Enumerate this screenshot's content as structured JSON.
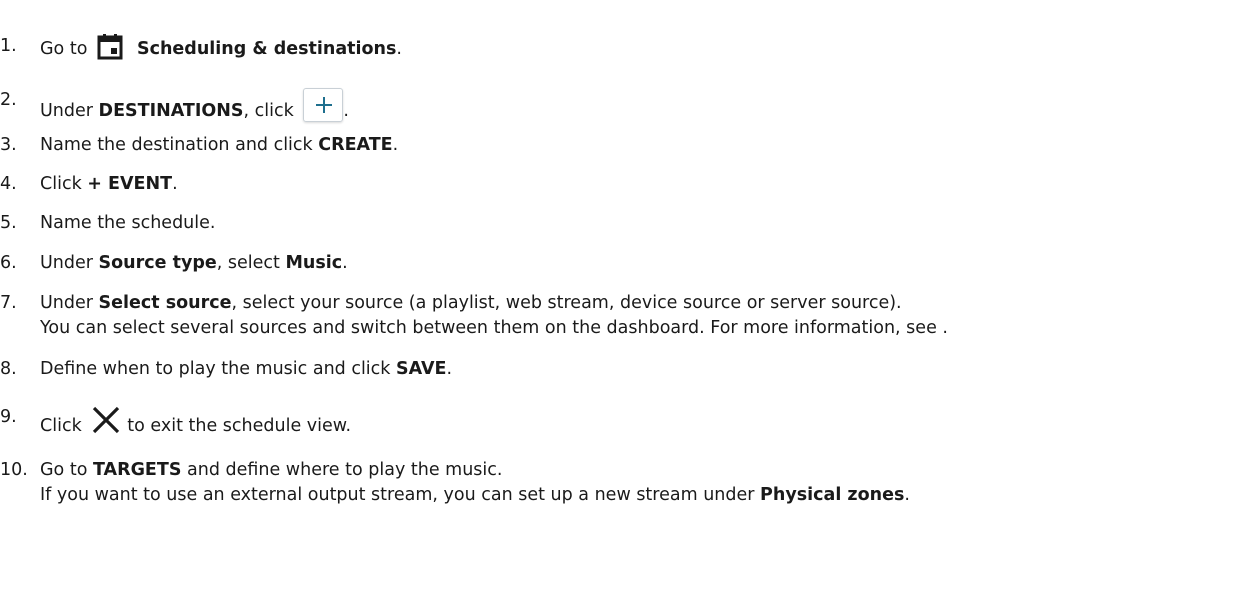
{
  "steps": [
    {
      "number": "1.",
      "pre": "Go to",
      "bold": "Scheduling & destinations",
      "post": ".",
      "icon": "calendar-icon"
    },
    {
      "number": "2.",
      "pre": "Under ",
      "bold": "DESTINATIONS",
      "post": ", click",
      "after_icon": ".",
      "icon": "plus-icon"
    },
    {
      "number": "3.",
      "pre": "Name the destination and click ",
      "bold": "CREATE",
      "post": "."
    },
    {
      "number": "4.",
      "pre": "Click ",
      "bold": "+ EVENT",
      "post": "."
    },
    {
      "number": "5.",
      "pre": "Name the schedule."
    },
    {
      "number": "6.",
      "pre": "Under ",
      "bold": "Source type",
      "mid": ", select ",
      "bold2": "Music",
      "post": "."
    },
    {
      "number": "7.",
      "pre": "Under ",
      "bold": "Select source",
      "post": ", select your source (a playlist, web stream, device source or server source).",
      "line2": "You can select several sources and switch between them on the dashboard. For more information, see ."
    },
    {
      "number": "8.",
      "pre": "Define when to play the music and click ",
      "bold": "SAVE",
      "post": "."
    },
    {
      "number": "9.",
      "pre": "Click",
      "post": "to exit the schedule view.",
      "icon": "close-icon"
    },
    {
      "number": "10.",
      "pre": "Go to ",
      "bold": "TARGETS",
      "post": " and define where to play the music.",
      "line2_pre": "If you want to use an external output stream, you can set up a new stream under ",
      "line2_bold": "Physical zones",
      "line2_post": "."
    }
  ],
  "colors": {
    "text": "#1a1a1a",
    "accent": "#1e6f8e"
  }
}
